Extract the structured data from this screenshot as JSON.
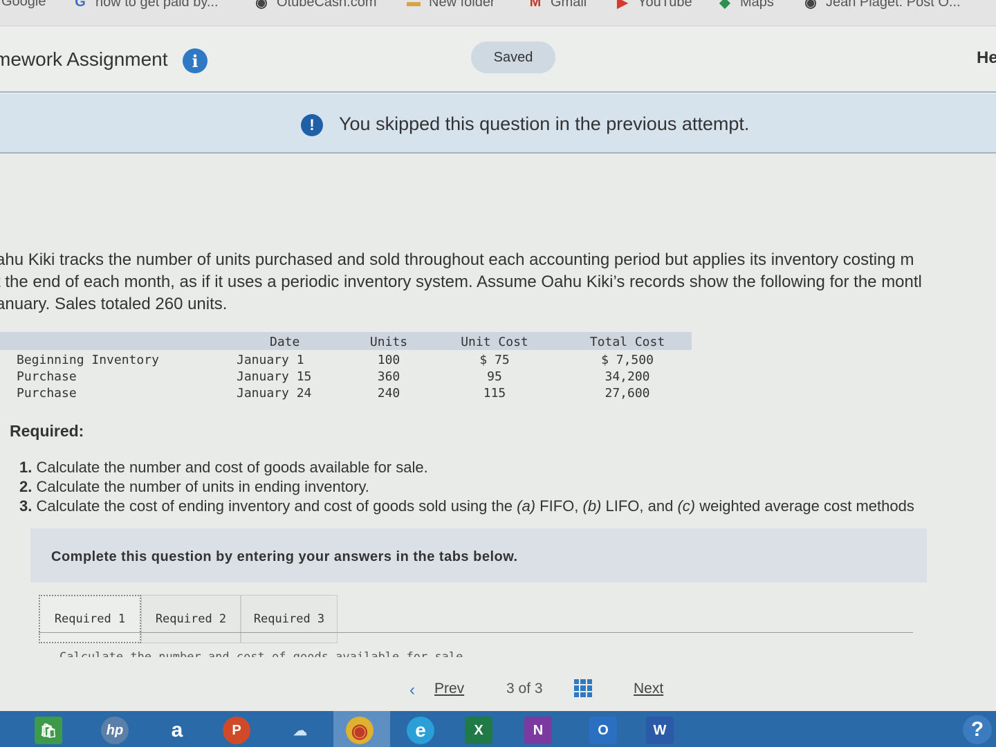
{
  "bookmarks": [
    {
      "label": "Google",
      "icon": "google-icon"
    },
    {
      "label": "how to get paid by...",
      "icon": "google-g-icon"
    },
    {
      "label": "OtubeCash.com",
      "icon": "globe-icon"
    },
    {
      "label": "New folder",
      "icon": "folder-icon"
    },
    {
      "label": "Gmail",
      "icon": "gmail-icon"
    },
    {
      "label": "YouTube",
      "icon": "youtube-icon"
    },
    {
      "label": "Maps",
      "icon": "maps-icon"
    },
    {
      "label": "Jean Piaget: Post O...",
      "icon": "globe-icon"
    }
  ],
  "header": {
    "title": "mework Assignment",
    "saved": "Saved",
    "help": "He"
  },
  "banner": {
    "text": "You skipped this question in the previous attempt."
  },
  "problem": {
    "lines": [
      "ahu Kiki tracks the number of units purchased and sold throughout each accounting period but applies its inventory costing m",
      "t the end of each month, as if it uses a periodic inventory system. Assume Oahu Kiki’s records show the following for the montl",
      "anuary. Sales totaled 260 units."
    ]
  },
  "table": {
    "headers": {
      "date": "Date",
      "units": "Units",
      "unit_cost": "Unit Cost",
      "total_cost": "Total Cost"
    },
    "rows": [
      {
        "label": "Beginning Inventory",
        "date": "January 1",
        "units": "100",
        "unit_cost": "$ 75",
        "total_cost": "$ 7,500"
      },
      {
        "label": "Purchase",
        "date": "January 15",
        "units": "360",
        "unit_cost": "95",
        "total_cost": "34,200"
      },
      {
        "label": "Purchase",
        "date": "January 24",
        "units": "240",
        "unit_cost": "115",
        "total_cost": "27,600"
      }
    ]
  },
  "required": {
    "title": "Required:",
    "items": [
      {
        "num": "1.",
        "text": "Calculate the number and cost of goods available for sale."
      },
      {
        "num": "2.",
        "text": "Calculate the number of units in ending inventory."
      },
      {
        "num": "3.",
        "text_a": "Calculate the cost of ending inventory and cost of goods sold using the ",
        "a": "(a)",
        "t1": " FIFO, ",
        "b": "(b)",
        "t2": " LIFO, and ",
        "c": "(c)",
        "t3": " weighted average cost methods"
      }
    ]
  },
  "instructions": "Complete this question by entering your answers in the tabs below.",
  "tabs": [
    {
      "label": "Required 1",
      "active": true
    },
    {
      "label": "Required 2",
      "active": false
    },
    {
      "label": "Required 3",
      "active": false
    }
  ],
  "cut_text": "Calculate the number and cost of goods available for sale",
  "pager": {
    "prev": "Prev",
    "page": "3",
    "of": "of",
    "total": "3",
    "next": "Next"
  },
  "taskbar": [
    {
      "icon": "store-icon",
      "label": "🛍"
    },
    {
      "icon": "hp-icon",
      "label": "hp"
    },
    {
      "icon": "amazon-icon",
      "label": "a"
    },
    {
      "icon": "powerpoint-icon",
      "label": "P"
    },
    {
      "icon": "onedrive-icon",
      "label": "☁"
    },
    {
      "icon": "chrome-icon",
      "label": "◉"
    },
    {
      "icon": "edge-icon",
      "label": "e"
    },
    {
      "icon": "excel-icon",
      "label": "X"
    },
    {
      "icon": "onenote-icon",
      "label": "N"
    },
    {
      "icon": "outlook-icon",
      "label": "O"
    },
    {
      "icon": "word-icon",
      "label": "W"
    }
  ],
  "taskbar_help": "?"
}
